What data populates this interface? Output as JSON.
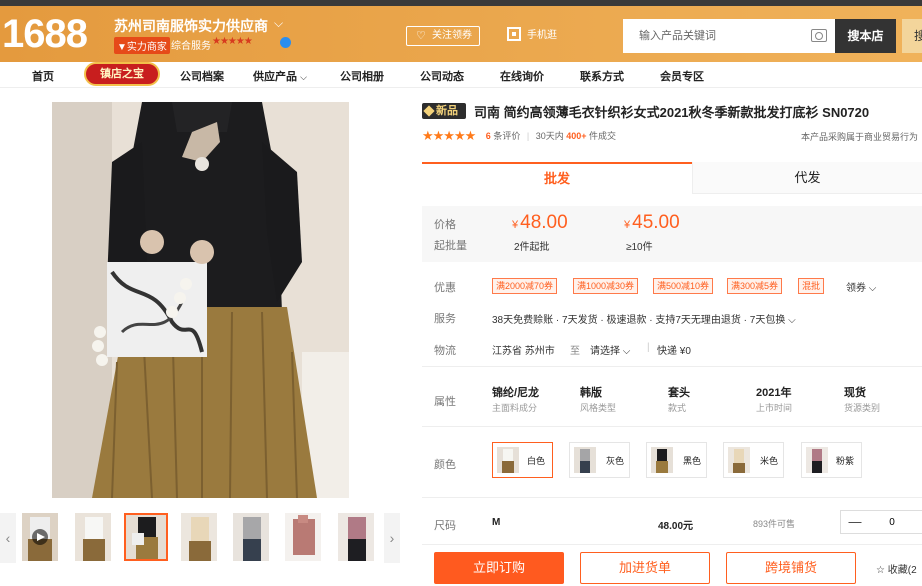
{
  "header": {
    "logo": "1688",
    "shop_name": "苏州司南服饰实力供应商",
    "badge": "实力商家",
    "service_label": "综合服务",
    "service_stars": "★★★★★",
    "follow_label": "关注领券",
    "mobile_label": "手机逛",
    "search_placeholder": "输入产品关键词",
    "search_button": "搜本店",
    "search_button2": "搜"
  },
  "nav": {
    "items": [
      "首页",
      "镇店之宝",
      "公司档案",
      "供应产品",
      "公司相册",
      "公司动态",
      "在线询价",
      "联系方式",
      "会员专区"
    ]
  },
  "product": {
    "new_badge": "新品",
    "title": "司南 简约高领薄毛衣针织衫女式2021秋冬季新款批发打底衫 SN0720",
    "rating_stars": "★★★★★",
    "review_count": "6",
    "review_label": "条评价",
    "days_label": "30天内",
    "sold_count": "400+",
    "sold_label": "件成交",
    "note": "本产品采购属于商业贸易行为"
  },
  "tabs": {
    "wholesale": "批发",
    "dropship": "代发"
  },
  "price": {
    "label_price": "价格",
    "label_moq": "起批量",
    "currency": "¥",
    "p1": "48.00",
    "p1_qty": "2件起批",
    "p2": "45.00",
    "p2_qty": "≥10件"
  },
  "coupons": {
    "label": "优惠",
    "items": [
      "满2000减70券",
      "满1000减30券",
      "满500减10券",
      "满300减5券",
      "混批"
    ],
    "get": "领券"
  },
  "service": {
    "label": "服务",
    "text": "38天免费赊账 · 7天发货 · 极速退款 · 支持7天无理由退货 · 7天包换"
  },
  "logistics": {
    "label": "物流",
    "from": "江苏省 苏州市",
    "to": "至",
    "select": "请选择",
    "sep": "|",
    "shipping": "快递 ¥0"
  },
  "attributes": {
    "label": "属性",
    "items": [
      {
        "value": "锦纶/尼龙",
        "key": "主面料成分"
      },
      {
        "value": "韩版",
        "key": "风格类型"
      },
      {
        "value": "套头",
        "key": "款式"
      },
      {
        "value": "2021年",
        "key": "上市时间"
      },
      {
        "value": "现货",
        "key": "货源类别"
      }
    ]
  },
  "colors": {
    "label": "颜色",
    "items": [
      "白色",
      "灰色",
      "黑色",
      "米色",
      "粉紫"
    ]
  },
  "size": {
    "label": "尺码",
    "value": "M",
    "price": "48.00元",
    "stock": "893件可售",
    "minus": "—",
    "qty": "0"
  },
  "actions": {
    "buy": "立即订购",
    "cart": "加进货单",
    "cross": "跨境铺货",
    "fav": "收藏(2"
  }
}
